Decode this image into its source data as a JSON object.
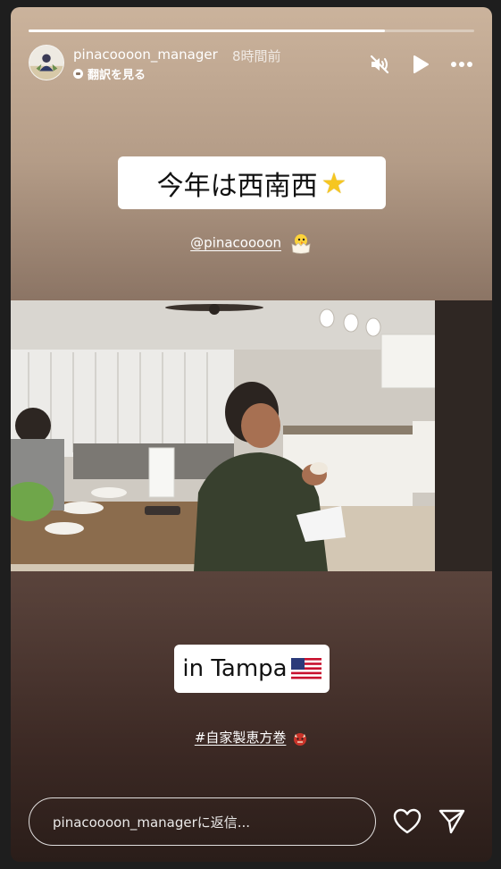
{
  "story": {
    "progress": 0.8,
    "username": "pinacoooon_manager",
    "timestamp": "8時間前",
    "translate_label": "翻訳を見る",
    "title_sticker": "今年は西南西",
    "mention": "@pinacoooon",
    "location_sticker": "in Tampa",
    "hashtag": "#自家製恵方巻"
  },
  "reply": {
    "placeholder": "pinacoooon_managerに返信..."
  },
  "icons": {
    "mute": "speaker-muted-icon",
    "play": "play-icon",
    "more": "more-dots-icon",
    "like": "heart-icon",
    "send": "send-icon",
    "star": "star-emoji",
    "chick": "hatching-chick-emoji",
    "flag": "us-flag-emoji",
    "oni": "ogre-emoji"
  },
  "colors": {
    "progress_track": "#8f7e70",
    "progress_fill": "#ffffff",
    "sticker_bg": "#ffffff"
  }
}
